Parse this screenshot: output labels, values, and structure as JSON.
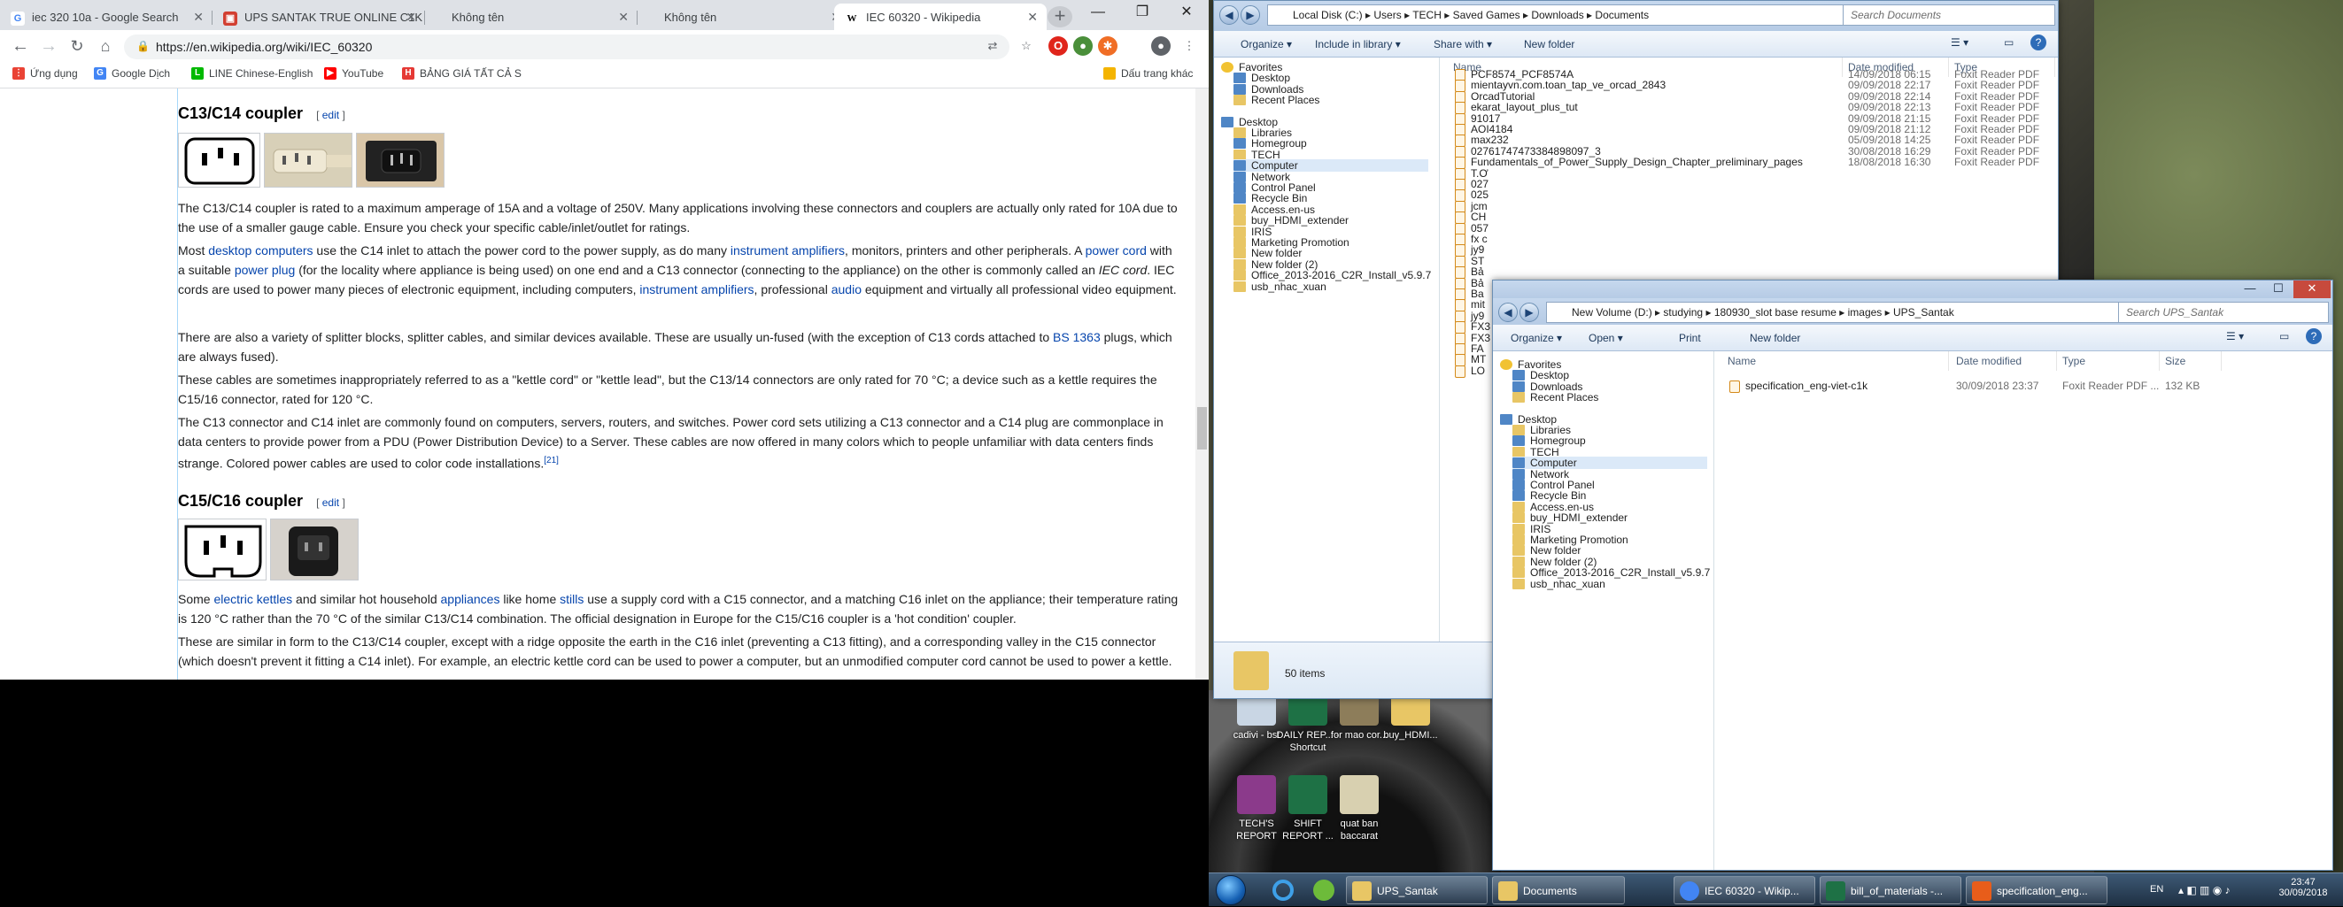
{
  "chrome": {
    "tabs": [
      {
        "title": "iec 320 10a - Google Search",
        "fav": "G",
        "fav_color": "#4285f4"
      },
      {
        "title": "UPS SANTAK TRUE ONLINE C1K",
        "fav": "▣",
        "fav_color": "#d23f31"
      },
      {
        "title": "Không tên",
        "fav": "",
        "fav_color": "#ffffff"
      },
      {
        "title": "Không tên",
        "fav": "",
        "fav_color": "#ffffff"
      },
      {
        "title": "IEC 60320 - Wikipedia",
        "fav": "W",
        "fav_color": "#000000"
      }
    ],
    "url": "https://en.wikipedia.org/wiki/IEC_60320",
    "bookmarks": [
      {
        "label": "Ứng dụng",
        "color": "#ea4335"
      },
      {
        "label": "Google Dịch",
        "color": "#4285f4"
      },
      {
        "label": "LINE Chinese-English",
        "color": "#00b900"
      },
      {
        "label": "YouTube",
        "color": "#ff0000"
      },
      {
        "label": "BẢNG GIÁ TẤT CẢ S",
        "color": "#e53935"
      },
      {
        "label": "Dấu trang khác",
        "color": "#f4b400"
      }
    ]
  },
  "wiki": {
    "c13_heading": "C13/C14 coupler",
    "c15_heading": "C15/C16 coupler",
    "edit": "edit",
    "p1": "The C13/C14 coupler is rated to a maximum amperage of 15A and a voltage of 250V. Many applications involving these connectors and couplers are actually only rated for 10A due to the use of a smaller gauge cable. Ensure you check your specific cable/inlet/outlet for ratings.",
    "p2": {
      "t1": "Most ",
      "l1": "desktop computers",
      "t2": " use the C14 inlet to attach the power cord to the power supply, as do many ",
      "l2": "instrument amplifiers",
      "t3": ", monitors, printers and other peripherals. A ",
      "l3": "power cord",
      "t4": " with a suitable ",
      "l4": "power plug",
      "t5": " (for the locality where appliance is being used) on one end and a C13 connector (connecting to the appliance) on the other is commonly called an ",
      "em": "IEC cord",
      "t6": ". IEC cords are used to power many pieces of electronic equipment, including computers, ",
      "l5": "instrument amplifiers",
      "t7": ", professional ",
      "l6": "audio",
      "t8": " equipment and virtually all professional video equipment."
    },
    "p3": {
      "t1": "There are also a variety of splitter blocks, splitter cables, and similar devices available. These are usually un-fused (with the exception of C13 cords attached to ",
      "l1": "BS 1363",
      "t2": " plugs, which are always fused)."
    },
    "p4": "These cables are sometimes inappropriately referred to as a \"kettle cord\" or \"kettle lead\", but the C13/14 connectors are only rated for 70 °C; a device such as a kettle requires the C15/16 connector, rated for 120 °C.",
    "p5": {
      "t1": "The C13 connector and C14 inlet are commonly found on computers, servers, routers, and switches. Power cord sets utilizing a C13 connector and a C14 plug are commonplace in data centers to provide power from a PDU (Power Distribution Device) to a Server. These cables are now offered in many colors which to people unfamiliar with data centers finds strange. Colored power cables are used to color code installations.",
      "sup": "[21]"
    },
    "p6": {
      "t1": "Some ",
      "l1": "electric kettles",
      "t2": " and similar hot household ",
      "l2": "appliances",
      "t3": " like home ",
      "l3": "stills",
      "t4": " use a supply cord with a C15 connector, and a matching C16 inlet on the appliance; their temperature rating is 120 °C rather than the 70 °C of the similar C13/C14 combination. The official designation in Europe for the C15/C16 coupler is a 'hot condition' coupler."
    },
    "p7": "These are similar in form to the C13/C14 coupler, except with a ridge opposite the earth in the C16 inlet (preventing a C13 fitting), and a corresponding valley in the C15 connector (which doesn't prevent it fitting a C14 inlet). For example, an electric kettle cord can be used to power a computer, but an unmodified computer cord cannot be used to power a kettle."
  },
  "explorer1": {
    "path": [
      "Local Disk (C:)",
      "Users",
      "TECH",
      "Saved Games",
      "Downloads",
      "Documents"
    ],
    "search_placeholder": "Search Documents",
    "commands": [
      "Organize ▾",
      "Include in library ▾",
      "Share with ▾",
      "New folder"
    ],
    "nav": [
      {
        "label": "Favorites",
        "type": "star",
        "indent": 0
      },
      {
        "label": "Desktop",
        "type": "blue",
        "indent": 1
      },
      {
        "label": "Downloads",
        "type": "blue",
        "indent": 1
      },
      {
        "label": "Recent Places",
        "type": "folder",
        "indent": 1
      },
      {
        "label": "Desktop",
        "type": "blue",
        "indent": 0
      },
      {
        "label": "Libraries",
        "type": "folder",
        "indent": 1
      },
      {
        "label": "Homegroup",
        "type": "blue",
        "indent": 1
      },
      {
        "label": "TECH",
        "type": "folder",
        "indent": 1
      },
      {
        "label": "Computer",
        "type": "blue",
        "indent": 1,
        "selected": true
      },
      {
        "label": "Network",
        "type": "blue",
        "indent": 1
      },
      {
        "label": "Control Panel",
        "type": "blue",
        "indent": 1
      },
      {
        "label": "Recycle Bin",
        "type": "blue",
        "indent": 1
      },
      {
        "label": "Access.en-us",
        "type": "folder",
        "indent": 1
      },
      {
        "label": "buy_HDMI_extender",
        "type": "folder",
        "indent": 1
      },
      {
        "label": "IRIS",
        "type": "folder",
        "indent": 1
      },
      {
        "label": "Marketing Promotion",
        "type": "folder",
        "indent": 1
      },
      {
        "label": "New folder",
        "type": "folder",
        "indent": 1
      },
      {
        "label": "New folder (2)",
        "type": "folder",
        "indent": 1
      },
      {
        "label": "Office_2013-2016_C2R_Install_v5.9.7",
        "type": "folder",
        "indent": 1
      },
      {
        "label": "usb_nhac_xuan",
        "type": "folder",
        "indent": 1
      }
    ],
    "columns": [
      "Name",
      "Date modified",
      "Type"
    ],
    "files": [
      {
        "name": "PCF8574_PCF8574A",
        "date": "14/09/2018 06:15",
        "type": "Foxit Reader PDF"
      },
      {
        "name": "mientayvn.com.toan_tap_ve_orcad_2843",
        "date": "09/09/2018 22:17",
        "type": "Foxit Reader PDF"
      },
      {
        "name": "OrcadTutorial",
        "date": "09/09/2018 22:14",
        "type": "Foxit Reader PDF"
      },
      {
        "name": "ekarat_layout_plus_tut",
        "date": "09/09/2018 22:13",
        "type": "Foxit Reader PDF"
      },
      {
        "name": "91017",
        "date": "09/09/2018 21:15",
        "type": "Foxit Reader PDF"
      },
      {
        "name": "AOI4184",
        "date": "09/09/2018 21:12",
        "type": "Foxit Reader PDF"
      },
      {
        "name": "max232",
        "date": "05/09/2018 14:25",
        "type": "Foxit Reader PDF"
      },
      {
        "name": "027617474733848980​97_3",
        "date": "30/08/2018 16:29",
        "type": "Foxit Reader PDF"
      },
      {
        "name": "Fundamentals_of_Power_Supply_Design_Chapter_preliminary_pages",
        "date": "18/08/2018 16:30",
        "type": "Foxit Reader PDF"
      },
      {
        "name": "T.Ơ",
        "date": "",
        "type": ""
      },
      {
        "name": "027",
        "date": "",
        "type": ""
      },
      {
        "name": "025",
        "date": "",
        "type": ""
      },
      {
        "name": "jcm",
        "date": "",
        "type": ""
      },
      {
        "name": "CH",
        "date": "",
        "type": ""
      },
      {
        "name": "057",
        "date": "",
        "type": ""
      },
      {
        "name": "fx c",
        "date": "",
        "type": ""
      },
      {
        "name": "jy9",
        "date": "",
        "type": ""
      },
      {
        "name": "ST",
        "date": "",
        "type": ""
      },
      {
        "name": "Bả",
        "date": "",
        "type": ""
      },
      {
        "name": "Bả",
        "date": "",
        "type": ""
      },
      {
        "name": "Ba",
        "date": "",
        "type": ""
      },
      {
        "name": "mit",
        "date": "",
        "type": ""
      },
      {
        "name": "jy9",
        "date": "",
        "type": ""
      },
      {
        "name": "FX3",
        "date": "",
        "type": ""
      },
      {
        "name": "FX3",
        "date": "",
        "type": ""
      },
      {
        "name": "FA",
        "date": "",
        "type": ""
      },
      {
        "name": "MT",
        "date": "",
        "type": ""
      },
      {
        "name": "LO",
        "date": "",
        "type": ""
      }
    ],
    "item_count": "50 items"
  },
  "explorer2": {
    "path": [
      "New Volume (D:)",
      "studying",
      "180930_slot base resume",
      "images",
      "UPS_Santak"
    ],
    "search_placeholder": "Search UPS_Santak",
    "commands": [
      "Organize ▾",
      "Open ▾",
      "Print",
      "New folder"
    ],
    "nav": [
      {
        "label": "Favorites",
        "type": "star",
        "indent": 0
      },
      {
        "label": "Desktop",
        "type": "blue",
        "indent": 1
      },
      {
        "label": "Downloads",
        "type": "blue",
        "indent": 1
      },
      {
        "label": "Recent Places",
        "type": "folder",
        "indent": 1
      },
      {
        "label": "Desktop",
        "type": "blue",
        "indent": 0
      },
      {
        "label": "Libraries",
        "type": "folder",
        "indent": 1
      },
      {
        "label": "Homegroup",
        "type": "blue",
        "indent": 1
      },
      {
        "label": "TECH",
        "type": "folder",
        "indent": 1
      },
      {
        "label": "Computer",
        "type": "blue",
        "indent": 1,
        "selected": true
      },
      {
        "label": "Network",
        "type": "blue",
        "indent": 1
      },
      {
        "label": "Control Panel",
        "type": "blue",
        "indent": 1
      },
      {
        "label": "Recycle Bin",
        "type": "blue",
        "indent": 1
      },
      {
        "label": "Access.en-us",
        "type": "folder",
        "indent": 1
      },
      {
        "label": "buy_HDMI_extender",
        "type": "folder",
        "indent": 1
      },
      {
        "label": "IRIS",
        "type": "folder",
        "indent": 1
      },
      {
        "label": "Marketing Promotion",
        "type": "folder",
        "indent": 1
      },
      {
        "label": "New folder",
        "type": "folder",
        "indent": 1
      },
      {
        "label": "New folder (2)",
        "type": "folder",
        "indent": 1
      },
      {
        "label": "Office_2013-2016_C2R_Install_v5.9.7",
        "type": "folder",
        "indent": 1
      },
      {
        "label": "usb_nhac_xuan",
        "type": "folder",
        "indent": 1
      }
    ],
    "columns": [
      "Name",
      "Date modified",
      "Type",
      "Size"
    ],
    "files": [
      {
        "name": "specification_eng-viet-c1k",
        "date": "30/09/2018 23:37",
        "type": "Foxit Reader PDF ...",
        "size": "132 KB"
      }
    ]
  },
  "desktop_icons": [
    {
      "label": "cadivi - bst",
      "color": "#c9d6e4"
    },
    {
      "label": "DAILY REP... - Shortcut",
      "color": "#1e7145"
    },
    {
      "label": "for mao cor...",
      "color": "#8d7d5a"
    },
    {
      "label": "buy_HDMI...",
      "color": "#e8c665"
    },
    {
      "label": "TECH'S REPORT",
      "color": "#8b3a8b"
    },
    {
      "label": "SHIFT REPORT ...",
      "color": "#1e7145"
    },
    {
      "label": "quat ban baccarat",
      "color": "#d8d0b0"
    }
  ],
  "taskbar": {
    "items": [
      {
        "label": "UPS_Santak",
        "color": "#e8c665"
      },
      {
        "label": "Documents",
        "color": "#e8c665"
      },
      {
        "label": "IEC 60320 - Wikip...",
        "color": "#4285f4"
      },
      {
        "label": "bill_of_materials -...",
        "color": "#1e7145"
      },
      {
        "label": "specification_eng...",
        "color": "#e85d1a"
      }
    ],
    "lang": "EN",
    "time": "23:47",
    "date": "30/09/2018"
  }
}
